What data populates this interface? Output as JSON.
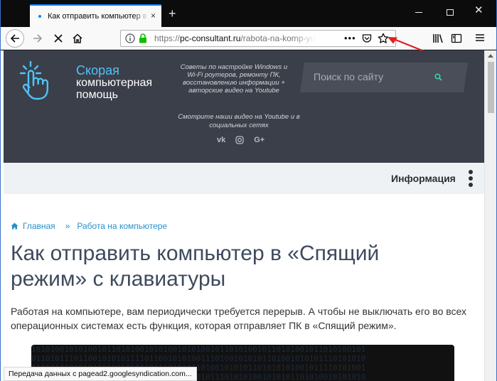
{
  "browser": {
    "tab_title": "Как отправить компьютер в сп",
    "tab_close": "×",
    "new_tab": "+",
    "url_scheme": "https://",
    "url_host": "pc-consultant.ru",
    "url_path": "/rabota-na-komp-yutere/",
    "url_more": "•••",
    "window_close": "✕"
  },
  "site": {
    "logo_line1": "Скорая",
    "logo_line2": "компьютерная",
    "logo_line3": "помощь",
    "tagline": "Советы по настройке Windows и Wi-Fi роутеров, ремонту ПК, восстановлению информации + авторские видео на Youtube",
    "tagline2": "Смотрите наши видео на Youtube и в социальных сетях",
    "social_vk": "vk",
    "social_gplus": "G+",
    "search_placeholder": "Поиск по сайту",
    "info_label": "Информация"
  },
  "breadcrumb": {
    "home": "Главная",
    "sep": "»",
    "section": "Работа на компьютере"
  },
  "article": {
    "title": "Как отправить компьютер в «Спящий режим» с клавиатуры",
    "lead": "Работая на компьютере, вам периодически требуется перерыв. А чтобы не выключать его во всех операционных системах есть функция, которая отправляет ПК в «Спящий режим»."
  },
  "status_text": "Передача данных с pagead2.googlesyndication.com...",
  "colors": {
    "header_bg": "#3b3f4a",
    "accent_blue": "#4fc3f7",
    "link": "#2a8fc9",
    "search_icon": "#37d3b0",
    "arrow_red": "#e02020"
  }
}
